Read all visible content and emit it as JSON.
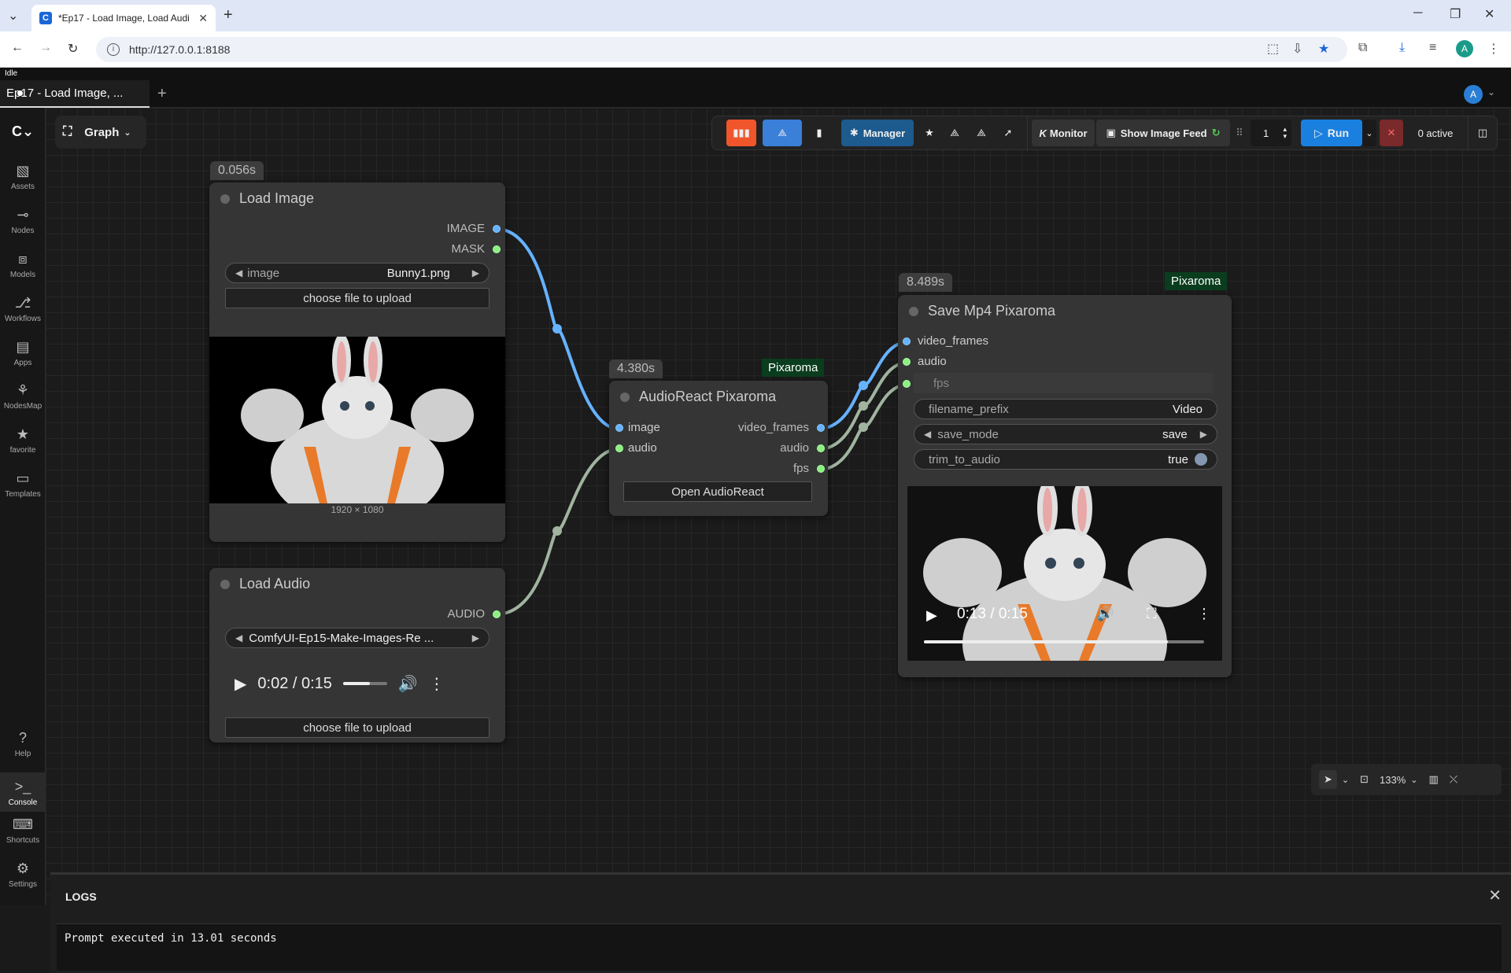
{
  "browser": {
    "tab_title": "*Ep17 - Load Image, Load Audi",
    "url": "http://127.0.0.1:8188",
    "profile_initial": "A"
  },
  "app": {
    "status": "Idle",
    "workflow_tab": "Ep17 - Load Image, ...",
    "user_initial": "A"
  },
  "sidebar": {
    "items": [
      {
        "label": "Assets",
        "icon": "image-icon"
      },
      {
        "label": "Nodes",
        "icon": "nodes-icon"
      },
      {
        "label": "Models",
        "icon": "models-icon"
      },
      {
        "label": "Workflows",
        "icon": "workflow-icon"
      },
      {
        "label": "Apps",
        "icon": "apps-icon"
      },
      {
        "label": "NodesMap",
        "icon": "nodesmap-icon"
      },
      {
        "label": "favorite",
        "icon": "star-icon"
      },
      {
        "label": "Templates",
        "icon": "templates-icon"
      }
    ],
    "bottom": [
      {
        "label": "Help",
        "icon": "help-icon"
      },
      {
        "label": "Console",
        "icon": "console-icon"
      },
      {
        "label": "Shortcuts",
        "icon": "keyboard-icon"
      },
      {
        "label": "Settings",
        "icon": "gear-icon"
      }
    ]
  },
  "toolbar": {
    "graph_label": "Graph",
    "manager_label": "Manager",
    "monitor_label": "Monitor",
    "image_feed_label": "Show Image Feed",
    "queue_count": "1",
    "run_label": "Run",
    "active_label": "0 active"
  },
  "nodes": {
    "load_image": {
      "time": "0.056s",
      "title": "Load Image",
      "outputs": [
        "IMAGE",
        "MASK"
      ],
      "image_widget_label": "image",
      "image_widget_value": "Bunny1.png",
      "upload_label": "choose file to upload",
      "dimensions": "1920 × 1080"
    },
    "load_audio": {
      "title": "Load Audio",
      "output": "AUDIO",
      "audio_value": "ComfyUI-Ep15-Make-Images-Re ...",
      "time_display": "0:02 / 0:15",
      "volume_fraction": 0.6,
      "upload_label": "choose file to upload"
    },
    "audioreact": {
      "time": "4.380s",
      "badge": "Pixaroma",
      "title": "AudioReact Pixaroma",
      "inputs": [
        "image",
        "audio"
      ],
      "outputs": [
        "video_frames",
        "audio",
        "fps"
      ],
      "button_label": "Open AudioReact"
    },
    "save_mp4": {
      "time": "8.489s",
      "badge": "Pixaroma",
      "title": "Save Mp4 Pixaroma",
      "inputs": [
        "video_frames",
        "audio",
        "fps"
      ],
      "filename_prefix_label": "filename_prefix",
      "filename_prefix_value": "Video",
      "save_mode_label": "save_mode",
      "save_mode_value": "save",
      "trim_label": "trim_to_audio",
      "trim_value": "true",
      "video_time": "0:13 / 0:15",
      "video_progress": 0.87
    }
  },
  "canvas": {
    "zoom": "133%"
  },
  "logs": {
    "title": "LOGS",
    "line": "Prompt executed in 13.01 seconds"
  }
}
